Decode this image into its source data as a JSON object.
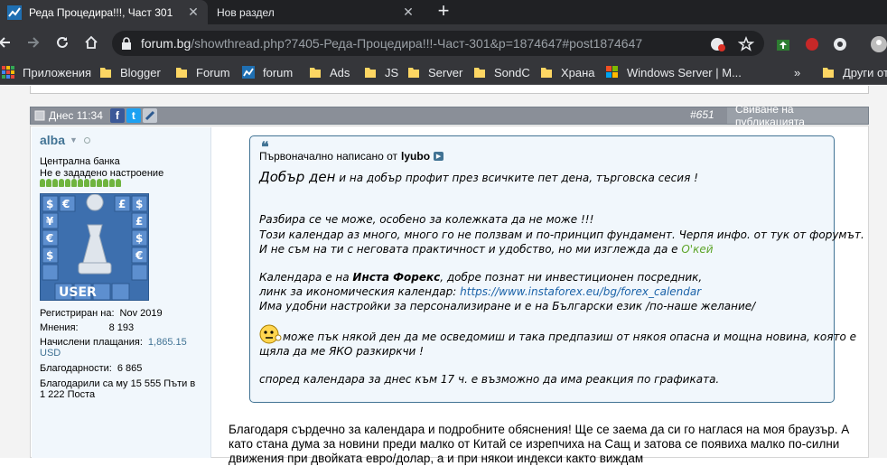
{
  "browser": {
    "tabs": [
      {
        "title": "Реда Процедира!!!, Част 301",
        "active": true
      },
      {
        "title": "Нов раздел",
        "active": false
      }
    ],
    "url_host": "forum.bg",
    "url_path": "/showthread.php?7405-Реда-Процедира!!!-Част-301&p=1874647#post1874647",
    "bookmarks": [
      "Приложения",
      "Blogger",
      "Forum",
      "forum",
      "Ads",
      "JS",
      "Server",
      "SondC",
      "Храна",
      "Windows Server | M...",
      "»",
      "Други от"
    ]
  },
  "post": {
    "date": "Днес 11:34",
    "number": "#651",
    "collapse_label": "Свиване на публикацията",
    "user": {
      "name": "alba",
      "title": "Централна банка",
      "mood": "Не е зададено настроение",
      "reputation_pips": 13,
      "avatar_label": "USER",
      "stats": [
        {
          "label": "Регистриран на:",
          "value": "Nov 2019"
        },
        {
          "label": "Мнения:",
          "value": "8 193"
        },
        {
          "label": "Начислени плащания:",
          "value": "1,865.15",
          "value2": "USD"
        },
        {
          "label": "Благодарности:",
          "value": "6 865"
        },
        {
          "label": "Благодарили са му 15 555 Пъти в",
          "value": "1 222 Поста"
        }
      ]
    },
    "quote": {
      "header": "Първоначално написано от",
      "author": "lyubo",
      "greeting_big": "Добър ден",
      "greeting_rest": " и на добър профит през всичките пет дена, търговска сесия !",
      "lines": [
        "Разбира се че може, особено за колежката да не може !!!",
        "Този календар аз много, много го не ползвам и по-принцип фундамент. Черпя инфо. от тук от форумът.",
        "И не съм на ти с неговата практичност и удобство, но ми изглежда да е "
      ],
      "okay": "О'кей",
      "cal_intro": "Календара е на ",
      "cal_name": "Инста Форекс",
      "cal_rest": ", добре познат ни инвестиционен посредник,",
      "link_label": "линк за икономическия календар: ",
      "link": "https://www.instaforex.eu/bg/forex_calendar",
      "settings": "Има удобни настройки за персонализиране и е на Български език /по-наше желание/",
      "hope1": " може пък някой ден да ме осведомиш и така предпазиш от някоя опасна и мощна новина, която е",
      "hope2": "щяла да ме ЯКО разкиркчи !",
      "last": "според календара за днес към 17 ч. е възможно да има реакция по графиката."
    },
    "reply": "Благодаря сърдечно за календара и подробните обяснения! Ще се заема да си го наглася на моя браузър. А като стана дума за новини преди малко от Китай се изрепчиха на Сащ и затова се появиха малко по-силни движения при двойката евро/долар, а и при някои индекси както виждам"
  }
}
